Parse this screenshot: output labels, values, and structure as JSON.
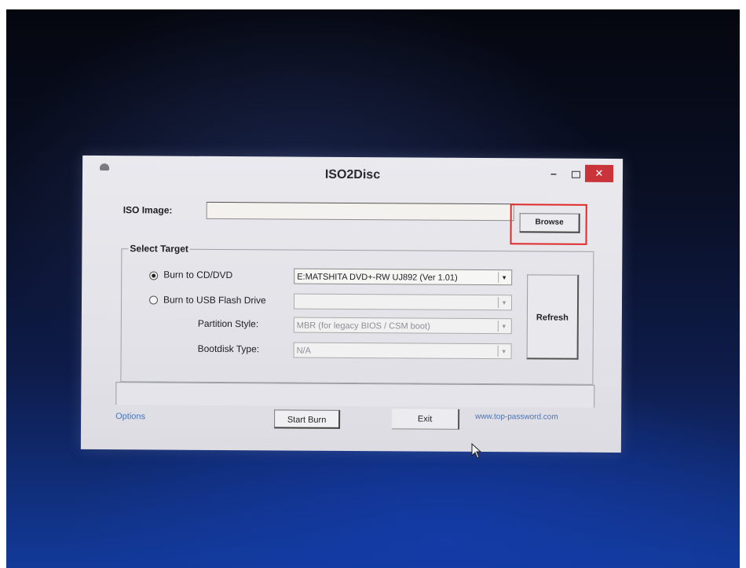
{
  "window": {
    "title": "ISO2Disc",
    "minimize_glyph": "–",
    "close_glyph": "✕"
  },
  "iso": {
    "label": "ISO Image:",
    "value": "",
    "browse_label": "Browse"
  },
  "target": {
    "group_title": "Select Target",
    "burn_cd_label": "Burn to CD/DVD",
    "burn_cd_selected": true,
    "drive_value": "E:MATSHITA DVD+-RW UJ892 (Ver 1.01)",
    "burn_usb_label": "Burn to USB Flash Drive",
    "usb_value": "",
    "partition_label": "Partition Style:",
    "partition_value": "MBR (for legacy BIOS / CSM boot)",
    "bootdisk_label": "Bootdisk Type:",
    "bootdisk_value": "N/A",
    "refresh_label": "Refresh"
  },
  "footer": {
    "options_label": "Options",
    "start_label": "Start Burn",
    "exit_label": "Exit",
    "site_label": "www.top-password.com"
  },
  "icons": {
    "dropdown": "▾"
  },
  "colors": {
    "highlight": "#e02a2a",
    "close_button": "#c9333a",
    "link": "#4a74b8"
  }
}
